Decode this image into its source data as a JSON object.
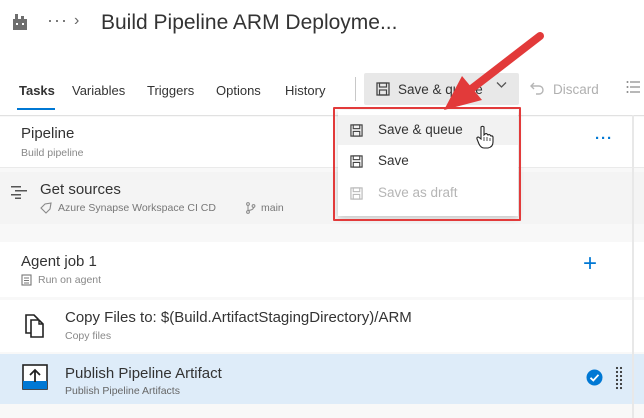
{
  "header": {
    "ellipsis": "···",
    "chevron": "›",
    "title": "Build Pipeline ARM Deployme..."
  },
  "toolbar": {
    "tabs": [
      {
        "label": "Tasks",
        "active": true
      },
      {
        "label": "Variables"
      },
      {
        "label": "Triggers"
      },
      {
        "label": "Options"
      },
      {
        "label": "History"
      }
    ],
    "save_queue_label": "Save & queue",
    "discard_label": "Discard"
  },
  "dropdown": {
    "items": [
      {
        "label": "Save & queue",
        "enabled": true,
        "hovered": true
      },
      {
        "label": "Save",
        "enabled": true
      },
      {
        "label": "Save as draft",
        "enabled": false
      }
    ]
  },
  "pipeline": {
    "title": "Pipeline",
    "subtitle": "Build pipeline",
    "more": "···"
  },
  "sources": {
    "title": "Get sources",
    "repo": "Azure Synapse Workspace CI CD",
    "branch": "main"
  },
  "agent_job": {
    "title": "Agent job 1",
    "subtitle": "Run on agent",
    "add": "+"
  },
  "tasks": [
    {
      "title": "Copy Files to: $(Build.ArtifactStagingDirectory)/ARM",
      "subtitle": "Copy files"
    },
    {
      "title": "Publish Pipeline Artifact",
      "subtitle": "Publish Pipeline Artifacts",
      "selected": true
    }
  ],
  "colors": {
    "accent": "#0078d4",
    "highlight_border": "#e23a3a",
    "selected_row": "#deecf9"
  }
}
